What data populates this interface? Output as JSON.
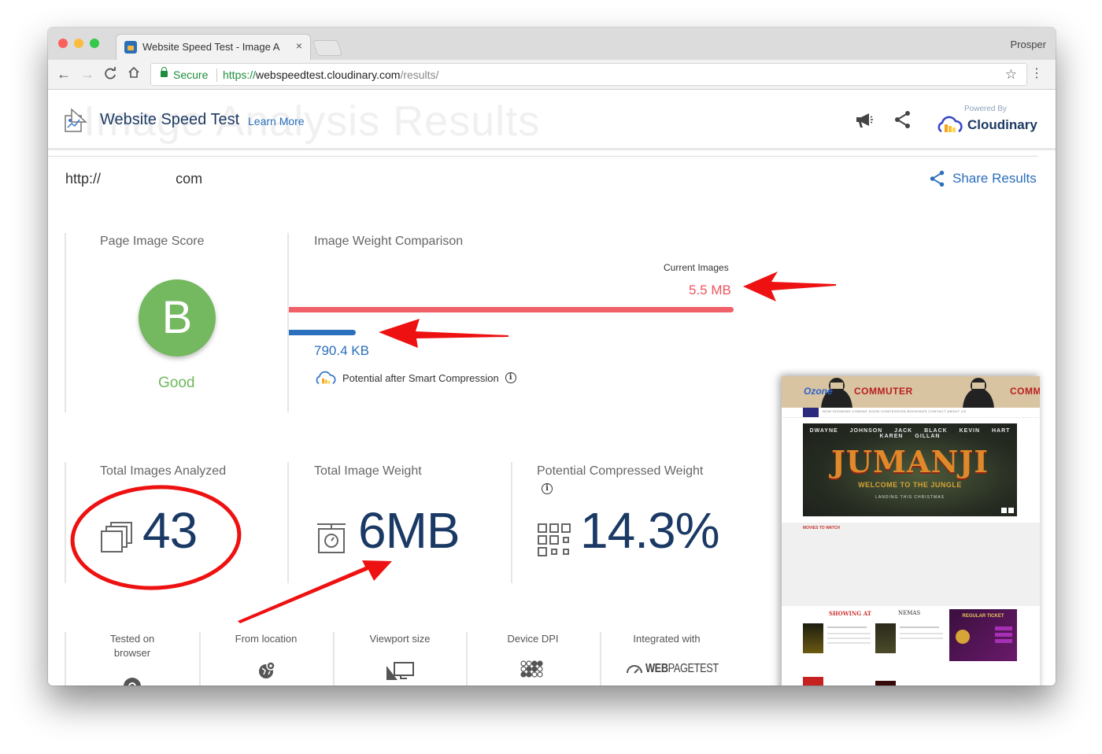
{
  "browser": {
    "tab_title": "Website Speed Test - Image A",
    "tab_close_glyph": "×",
    "profile_name": "Prosper",
    "nav_back_glyph": "←",
    "nav_forward_glyph": "→",
    "nav_reload_glyph": "C",
    "nav_home_glyph": "⌂",
    "secure_label": "Secure",
    "url_scheme": "https://",
    "url_host": "webspeedtest.cloudinary.com",
    "url_path": "/results/",
    "bookmark_glyph": "☆",
    "menu_glyph": "⋮"
  },
  "header": {
    "watermark": "Image Analysis Results",
    "title": "Website Speed Test",
    "learn_more": "Learn More",
    "powered_by": "Powered By",
    "brand": "Cloudinary"
  },
  "tested_url": {
    "prefix": "http://",
    "suffix": "com"
  },
  "share_results": "Share Results",
  "score": {
    "title": "Page Image Score",
    "grade": "B",
    "label": "Good",
    "color": "#74b85f"
  },
  "comparison": {
    "title": "Image Weight Comparison",
    "current_label": "Current Images",
    "current_value": "5.5 MB",
    "current_fraction": 1.0,
    "compressed_value": "790.4 KB",
    "compressed_fraction": 0.151,
    "compressed_caption": "Potential after Smart Compression",
    "info_glyph": "i",
    "current_color": "#ef6068",
    "compressed_color": "#2b70bd"
  },
  "stats": {
    "total_images_title": "Total Images Analyzed",
    "total_images_value": "43",
    "total_weight_title": "Total Image Weight",
    "total_weight_value": "6MB",
    "compressed_title": "Potential Compressed Weight",
    "compressed_value": "14.3%",
    "info_glyph": "i"
  },
  "meta": {
    "browser_label": "Tested on browser",
    "location_label": "From location",
    "viewport_label": "Viewport size",
    "dpi_label": "Device DPI",
    "integrated_label": "Integrated with",
    "integrated_brand_bold": "WEB",
    "integrated_brand_light": "PAGETEST"
  },
  "thumbnail": {
    "brand": "Ozone",
    "banner_text": "COMMUTER",
    "nav_items": "NOW SHOWING   COMING SOON   CONCESSION   BOOKINGS   CONTACT   ABOUT US",
    "actors": "DWAYNE JOHNSON  JACK BLACK  KEVIN HART  KAREN GILLAN",
    "movie_title": "JUMANJI",
    "movie_subtitle": "WELCOME TO THE JUNGLE",
    "movie_tagline": "LANDING THIS CHRISTMAS",
    "movies_heading": "MOVIES TO WATCH",
    "showing_at": "SHOWING AT",
    "cinemas": "NEMAS",
    "ticket_heading": "REGULAR TICKET"
  }
}
